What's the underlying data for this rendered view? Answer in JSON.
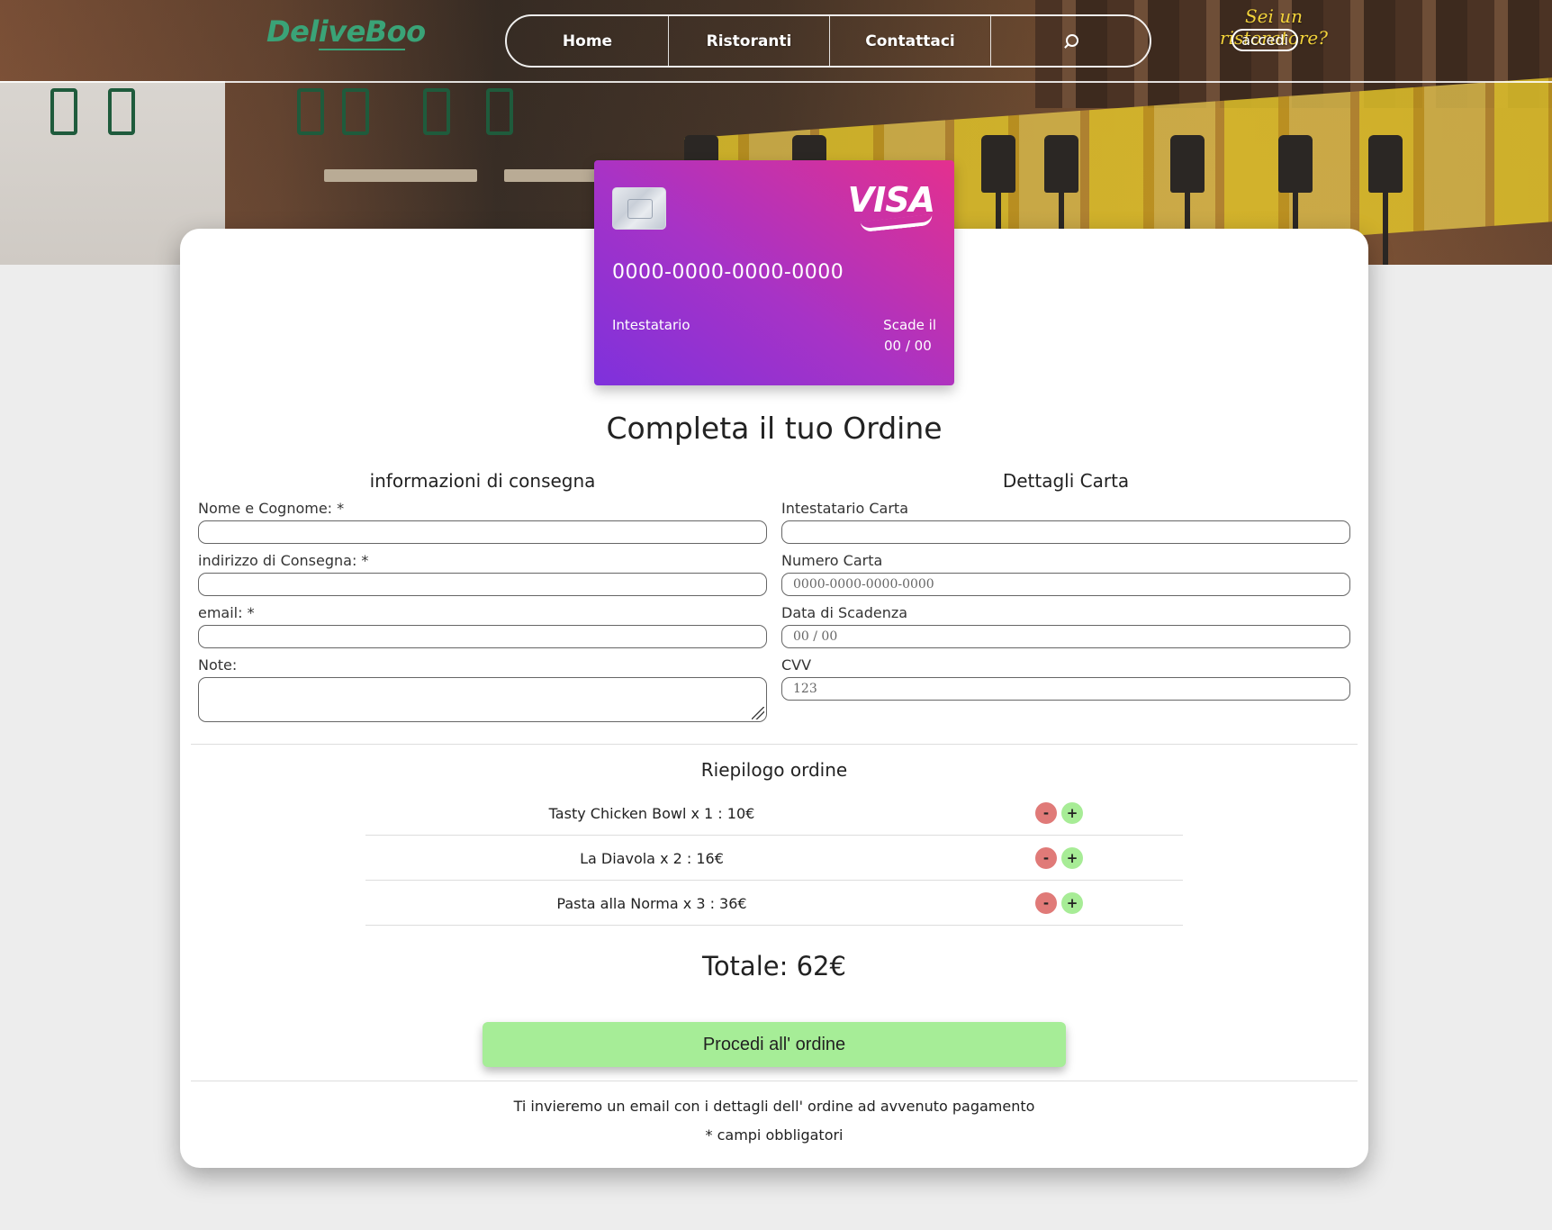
{
  "header": {
    "logo": "DeliveBoo",
    "nav": [
      "Home",
      "Ristoranti",
      "Contattaci"
    ],
    "restaurateur_prompt": "Sei un ristoratore?",
    "login_label": "accedi"
  },
  "credit_card": {
    "brand": "VISA",
    "number": "0000-0000-0000-0000",
    "holder_label": "Intestatario",
    "expires_label": "Scade il",
    "expires_value": "00 / 00"
  },
  "page_title": "Completa il tuo Ordine",
  "delivery": {
    "heading": "informazioni di consegna",
    "name_label": "Nome e Cognome: *",
    "address_label": "indirizzo di Consegna: *",
    "email_label": "email: *",
    "notes_label": "Note:",
    "name_value": "",
    "address_value": "",
    "email_value": "",
    "notes_value": ""
  },
  "card_details": {
    "heading": "Dettagli Carta",
    "holder_label": "Intestatario Carta",
    "number_label": "Numero Carta",
    "expiry_label": "Data di Scadenza",
    "cvv_label": "CVV",
    "holder_value": "",
    "number_placeholder": "0000-0000-0000-0000",
    "expiry_placeholder": "00 / 00",
    "cvv_placeholder": "123"
  },
  "summary": {
    "heading": "Riepilogo ordine",
    "items": [
      {
        "text": "Tasty Chicken Bowl x 1 : 10€",
        "minus": "-",
        "plus": "+"
      },
      {
        "text": "La Diavola x 2 : 16€",
        "minus": "-",
        "plus": "+"
      },
      {
        "text": "Pasta alla Norma x 3 : 36€",
        "minus": "-",
        "plus": "+"
      }
    ],
    "total": "Totale: 62€"
  },
  "proceed_label": "Procedi all' ordine",
  "footer": {
    "email_notice": "Ti invieremo un email con i dettagli dell' ordine ad avvenuto pagamento",
    "required_notice": "* campi obbligatori"
  },
  "colors": {
    "brand_green": "#3aa377",
    "proceed_green": "#a6ed97",
    "minus_red": "#e07a78",
    "plus_green": "#a7ec96",
    "card_gradient_start": "#7e31dc",
    "card_gradient_end": "#e4308e"
  },
  "icons": {
    "search": "search-icon",
    "chip": "card-chip-icon",
    "resize": "resize-grip-icon"
  }
}
